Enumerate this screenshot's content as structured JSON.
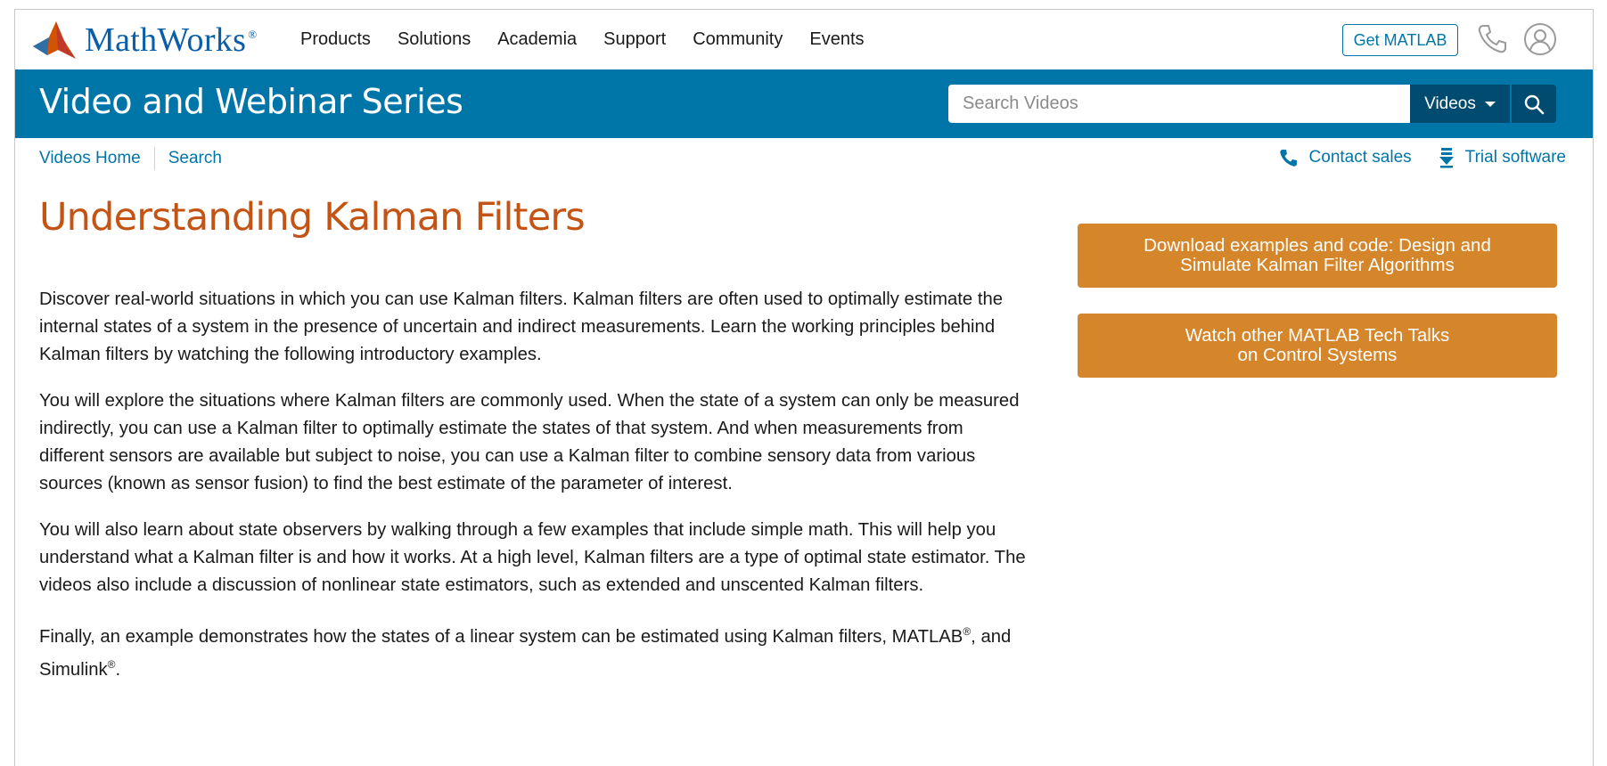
{
  "brand": {
    "name": "MathWorks",
    "reg": "®"
  },
  "nav": {
    "items": [
      "Products",
      "Solutions",
      "Academia",
      "Support",
      "Community",
      "Events"
    ],
    "get_matlab": "Get MATLAB"
  },
  "header": {
    "title": "Video and Webinar Series",
    "search_placeholder": "Search Videos",
    "search_scope": "Videos"
  },
  "subnav": {
    "home": "Videos Home",
    "search": "Search",
    "contact_sales": "Contact sales",
    "trial_software": "Trial software"
  },
  "page": {
    "title": "Understanding Kalman Filters",
    "paragraphs": [
      "Discover real-world situations in which you can use Kalman filters. Kalman filters are often used to optimally estimate the internal states of a system in the presence of uncertain and indirect measurements. Learn the working principles behind Kalman filters by watching the following introductory examples.",
      "You will explore the situations where Kalman filters are commonly used. When the state of a system can only be measured indirectly, you can use a Kalman filter to optimally estimate the states of that system. And when measurements from different sensors are available but subject to noise, you can use a Kalman filter to combine sensory data from various sources (known as sensor fusion) to find the best estimate of the parameter of interest.",
      "You will also learn about state observers by walking through a few examples that include simple math. This will help you understand what a Kalman filter is and how it works. At a high level, Kalman filters are a type of optimal state estimator. The videos also include a discussion of nonlinear state estimators, such as extended and unscented Kalman filters."
    ],
    "final_paragraph": {
      "text_before": "Finally, an example demonstrates how the states of a linear system can be estimated using Kalman filters, MATLAB",
      "reg1": "®",
      "text_middle": ", and Simulink",
      "reg2": "®",
      "text_after": "."
    }
  },
  "sidebar": {
    "cta1_line1": "Download examples and code: Design and",
    "cta1_line2": "Simulate Kalman Filter Algorithms",
    "cta2_line1": "Watch other MATLAB Tech Talks",
    "cta2_line2": "on Control Systems"
  },
  "colors": {
    "brand_blue": "#0076a8",
    "dark_blue": "#004b6f",
    "title_orange": "#c45414",
    "cta_orange": "#d5862b"
  },
  "icons": {
    "logo": "membrane-logo-icon",
    "phone": "phone-icon",
    "user": "user-account-icon",
    "search": "search-icon",
    "contact": "phone-handset-icon",
    "download": "download-icon"
  }
}
